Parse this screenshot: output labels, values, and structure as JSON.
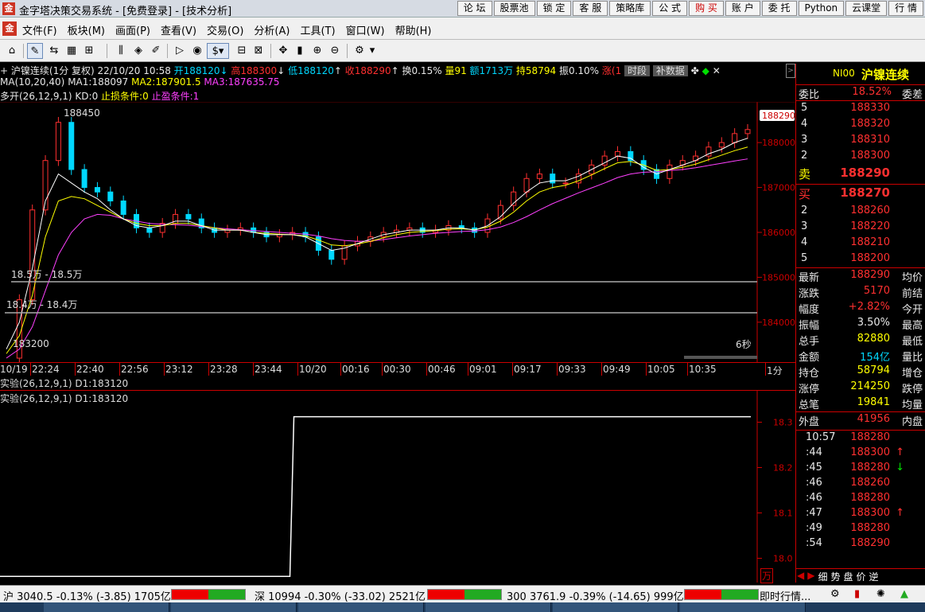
{
  "window": {
    "title": "金字塔决策交易系统 - [免费登录] - [技术分析]",
    "top_buttons": [
      "论 坛",
      "股票池",
      "锁 定",
      "客 服",
      "策略库",
      "公 式",
      "购 买",
      "账 户",
      "委 托",
      "Python",
      "云课堂",
      "行 情"
    ]
  },
  "menu": [
    "文件(F)",
    "板块(M)",
    "画面(P)",
    "查看(V)",
    "交易(O)",
    "分析(A)",
    "工具(T)",
    "窗口(W)",
    "帮助(H)"
  ],
  "info": {
    "symbol": "沪镍连续(1分 复权)",
    "datetime": "22/10/20 10:58",
    "open": "开188120",
    "high": "高188300",
    "low": "低188120",
    "close": "收188290",
    "turnover": "换0.15%",
    "volume": "量91",
    "amount": "额1713万",
    "position": "持58794",
    "amplitude": "振0.10%",
    "change": "涨(1",
    "btn_time": "时段",
    "btn_fill": "补数据",
    "ma_label": "MA(10,20,40)",
    "ma1": "MA1:188097",
    "ma2": "MA2:187901.5",
    "ma3": "MA3:187635.75",
    "strategy": "多开(26,12,9,1) KD:0",
    "stoploss": "止损条件:0",
    "takeprofit": "止盈条件:1"
  },
  "chart_data": {
    "type": "line",
    "title": "沪镍连续(1分 复权)",
    "ylim": [
      183200,
      188800
    ],
    "y_ticks": [
      "188000",
      "187000",
      "186000",
      "185000",
      "184000"
    ],
    "x_ticks": [
      "10/19",
      "22:24",
      "22:40",
      "22:56",
      "23:12",
      "23:28",
      "23:44",
      "10/20",
      "00:16",
      "00:30",
      "00:46",
      "09:01",
      "09:17",
      "09:33",
      "09:49",
      "10:05",
      "10:35",
      "1分"
    ],
    "last_price_tag": "188290",
    "high_label": "188450",
    "low_label": "183200",
    "hline1": "18.5万 - 18.5万",
    "hline2": "18.4万 - 18.4万",
    "timer": "6秒",
    "price": [
      183200,
      184500,
      186500,
      187600,
      188450,
      187400,
      187000,
      186900,
      186700,
      186400,
      186100,
      186000,
      186200,
      186400,
      186300,
      186100,
      186000,
      186050,
      186100,
      186000,
      185900,
      185950,
      186000,
      185900,
      185600,
      185400,
      185700,
      185800,
      185900,
      186000,
      186050,
      186100,
      186000,
      186050,
      186150,
      186100,
      186000,
      186300,
      186600,
      186900,
      187200,
      187300,
      187100,
      187100,
      187300,
      187500,
      187700,
      187800,
      187600,
      187400,
      187200,
      187500,
      187600,
      187700,
      187900,
      188000,
      188200,
      188290
    ],
    "ma1": [
      183400,
      184000,
      185200,
      186700,
      187300,
      187100,
      186900,
      186750,
      186500,
      186300,
      186150,
      186100,
      186150,
      186250,
      186250,
      186150,
      186050,
      186050,
      186050,
      186000,
      185950,
      185950,
      185950,
      185900,
      185750,
      185600,
      185650,
      185750,
      185850,
      185950,
      186000,
      186050,
      186050,
      186050,
      186100,
      186100,
      186050,
      186150,
      186350,
      186650,
      186900,
      187100,
      187150,
      187150,
      187250,
      187400,
      187550,
      187700,
      187650,
      187450,
      187300,
      187400,
      187500,
      187600,
      187750,
      187850,
      188000,
      188097
    ],
    "ma2": [
      183300,
      183700,
      184600,
      185900,
      186700,
      186800,
      186750,
      186600,
      186450,
      186300,
      186200,
      186150,
      186150,
      186200,
      186200,
      186150,
      186100,
      186050,
      186050,
      186000,
      185980,
      185960,
      185950,
      185920,
      185830,
      185720,
      185700,
      185740,
      185800,
      185880,
      185950,
      186000,
      186020,
      186040,
      186070,
      186080,
      186060,
      186120,
      186250,
      186450,
      186700,
      186900,
      187000,
      187050,
      187150,
      187280,
      187420,
      187550,
      187580,
      187500,
      187380,
      187400,
      187450,
      187520,
      187620,
      187720,
      187820,
      187901
    ],
    "ma3": [
      183200,
      183400,
      183900,
      184700,
      185500,
      186000,
      186300,
      186400,
      186380,
      186300,
      186250,
      186200,
      186180,
      186170,
      186160,
      186130,
      186100,
      186080,
      186060,
      186040,
      186020,
      186000,
      185980,
      185960,
      185920,
      185860,
      185820,
      185800,
      185810,
      185840,
      185880,
      185920,
      185950,
      185980,
      186000,
      186020,
      186030,
      186060,
      186120,
      186220,
      186350,
      186500,
      186640,
      186760,
      186880,
      186990,
      187100,
      187220,
      187300,
      187340,
      187350,
      187380,
      187400,
      187440,
      187490,
      187540,
      187590,
      187636
    ]
  },
  "indicator": {
    "line1": "实验(26,12,9,1) D1:183120",
    "line2": "实验(26,12,9,1) D1:183120",
    "y_ticks": [
      "18.3",
      "18.2",
      "18.1",
      "18.0"
    ],
    "bottom_label": "万",
    "ylim": [
      179500,
      183500
    ],
    "step_low": 179600,
    "step_high": 183120,
    "step_at": 0.385
  },
  "quote": {
    "code": "NI00",
    "name": "沪镍连续",
    "weibi_label": "委比",
    "weibi_val": "18.52%",
    "weicha_label": "委差",
    "sell": [
      {
        "n": "5",
        "p": "188330"
      },
      {
        "n": "4",
        "p": "188320"
      },
      {
        "n": "3",
        "p": "188310"
      },
      {
        "n": "2",
        "p": "188300"
      }
    ],
    "sell1": {
      "label": "卖",
      "p": "188290"
    },
    "buy1": {
      "label": "买",
      "p": "188270"
    },
    "buy": [
      {
        "n": "2",
        "p": "188260"
      },
      {
        "n": "3",
        "p": "188220"
      },
      {
        "n": "4",
        "p": "188210"
      },
      {
        "n": "5",
        "p": "188200"
      }
    ],
    "stats": [
      {
        "l": "最新",
        "v": "188290",
        "r": "均价",
        "cls": "r"
      },
      {
        "l": "涨跌",
        "v": "5170",
        "r": "前结",
        "cls": "r"
      },
      {
        "l": "幅度",
        "v": "+2.82%",
        "r": "今开",
        "cls": "r"
      },
      {
        "l": "振幅",
        "v": "3.50%",
        "r": "最高",
        "cls": "w"
      },
      {
        "l": "总手",
        "v": "82880",
        "r": "最低",
        "cls": "y"
      },
      {
        "l": "金额",
        "v": "154亿",
        "r": "量比",
        "cls": "c"
      },
      {
        "l": "持仓",
        "v": "58794",
        "r": "增仓",
        "cls": "y"
      },
      {
        "l": "涨停",
        "v": "214250",
        "r": "跌停",
        "cls": "y"
      },
      {
        "l": "总笔",
        "v": "19841",
        "r": "均量",
        "cls": "y"
      }
    ],
    "waipan_label": "外盘",
    "waipan_val": "41956",
    "neipan_label": "内盘",
    "ticks": [
      {
        "t": "10:57",
        "p": "188280",
        "a": ""
      },
      {
        "t": ":44",
        "p": "188300",
        "a": "↑"
      },
      {
        "t": ":45",
        "p": "188280",
        "a": "↓"
      },
      {
        "t": ":46",
        "p": "188260",
        "a": ""
      },
      {
        "t": ":46",
        "p": "188280",
        "a": ""
      },
      {
        "t": ":47",
        "p": "188300",
        "a": "↑"
      },
      {
        "t": ":49",
        "p": "188280",
        "a": ""
      },
      {
        "t": ":54",
        "p": "188290",
        "a": ""
      }
    ],
    "tabs": [
      "细",
      "势",
      "盘",
      "价",
      "逆"
    ]
  },
  "status": {
    "sh": "沪 3040.5 -0.13% (-3.85) 1705亿",
    "sz": "深 10994 -0.30% (-33.02) 2521亿",
    "hs300": "300 3761.9 -0.39% (-14.65) 999亿",
    "ticker": "即时行情..."
  }
}
